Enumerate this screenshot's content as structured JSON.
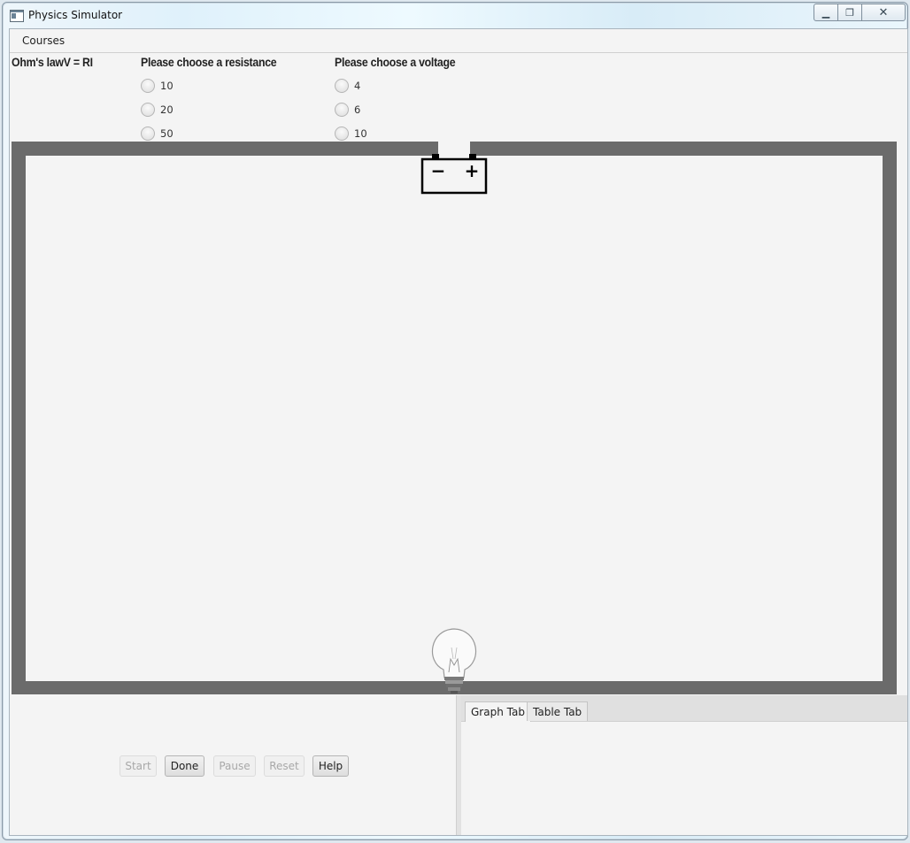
{
  "window": {
    "title": "Physics Simulator"
  },
  "menu": {
    "courses": "Courses"
  },
  "header": {
    "formula": "Ohm's lawV = RI",
    "resistance_label": "Please choose a resistance",
    "voltage_label": "Please choose a voltage"
  },
  "resistance_options": [
    "10",
    "20",
    "50"
  ],
  "voltage_options": [
    "4",
    "6",
    "10"
  ],
  "battery": {
    "minus": "−",
    "plus": "+"
  },
  "controls": {
    "start": "Start",
    "done": "Done",
    "pause": "Pause",
    "reset": "Reset",
    "help": "Help"
  },
  "tabs": [
    "Graph Tab",
    "Table Tab"
  ],
  "colors": {
    "wire": "#6b6b6b",
    "background": "#f4f4f4"
  }
}
